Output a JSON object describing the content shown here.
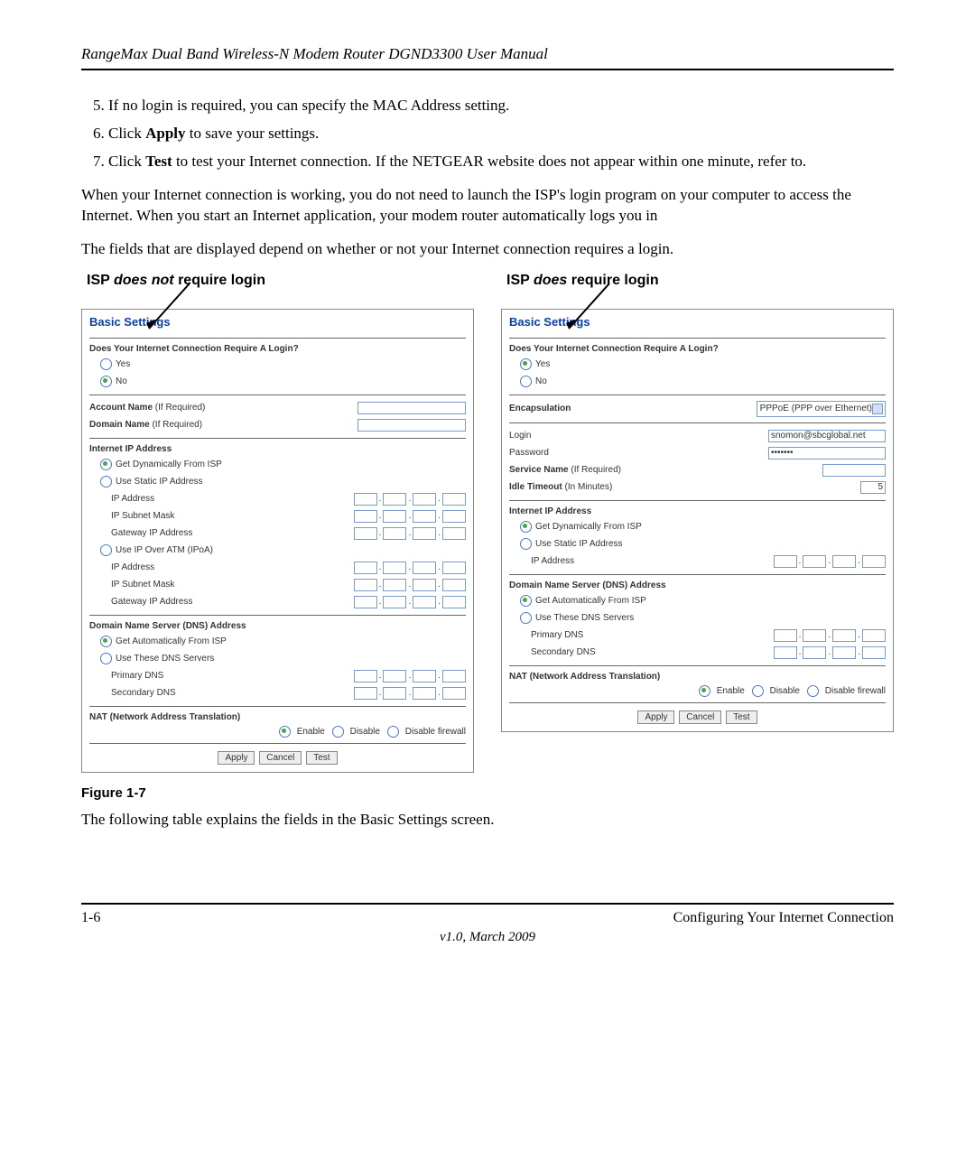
{
  "header": {
    "title": "RangeMax Dual Band Wireless-N Modem Router DGND3300 User Manual"
  },
  "steps": {
    "s5_num": "5.",
    "s5": "If no login is required, you can specify the MAC Address setting.",
    "s6_num": "6.",
    "s6_a": "Click ",
    "s6_b": "Apply",
    "s6_c": " to save your settings.",
    "s7_num": "7.",
    "s7_a": "Click ",
    "s7_b": "Test",
    "s7_c": " to test your Internet connection. If the NETGEAR website does not appear within one minute, refer to."
  },
  "para1": "When your Internet connection is working, you do not need to launch the ISP's login program on your computer to access the Internet. When you start an Internet application, your modem router automatically logs you in",
  "para2": "The fields that are displayed depend on whether or not your Internet connection requires a login.",
  "colA_title_a": "ISP ",
  "colA_title_b": "does not",
  "colA_title_c": " require login",
  "colB_title_a": "ISP ",
  "colB_title_b": "does",
  "colB_title_c": " require login",
  "panel": {
    "title": "Basic Settings",
    "q": "Does Your Internet Connection Require A Login?",
    "yes": "Yes",
    "no": "No",
    "account_name": "Account Name",
    "if_required": "(If Required)",
    "domain_name": "Domain Name",
    "internet_ip": "Internet IP Address",
    "get_dyn": "Get Dynamically From ISP",
    "use_static": "Use Static IP Address",
    "ip_address": "IP Address",
    "ip_subnet": "IP Subnet Mask",
    "gateway_ip": "Gateway IP Address",
    "use_ipoa": "Use IP Over ATM (IPoA)",
    "dns_head": "Domain Name Server (DNS) Address",
    "get_auto": "Get Automatically From ISP",
    "use_these": "Use These DNS Servers",
    "primary_dns": "Primary DNS",
    "secondary_dns": "Secondary DNS",
    "nat_head": "NAT (Network Address Translation)",
    "enable": "Enable",
    "disable": "Disable",
    "disable_fw": "Disable firewall",
    "apply": "Apply",
    "cancel": "Cancel",
    "test": "Test",
    "encapsulation": "Encapsulation",
    "encap_val": "PPPoE (PPP over Ethernet)",
    "login": "Login",
    "login_val": "snomon@sbcglobal.net",
    "password": "Password",
    "password_val": "•••••••",
    "service_name": "Service Name",
    "idle_timeout": "Idle Timeout",
    "in_minutes": "(In Minutes)",
    "idle_val": "5"
  },
  "fig_caption": "Figure 1-7",
  "para3": "The following table explains the fields in the Basic Settings screen.",
  "footer": {
    "page": "1-6",
    "chapter": "Configuring Your Internet Connection",
    "version": "v1.0, March 2009"
  }
}
